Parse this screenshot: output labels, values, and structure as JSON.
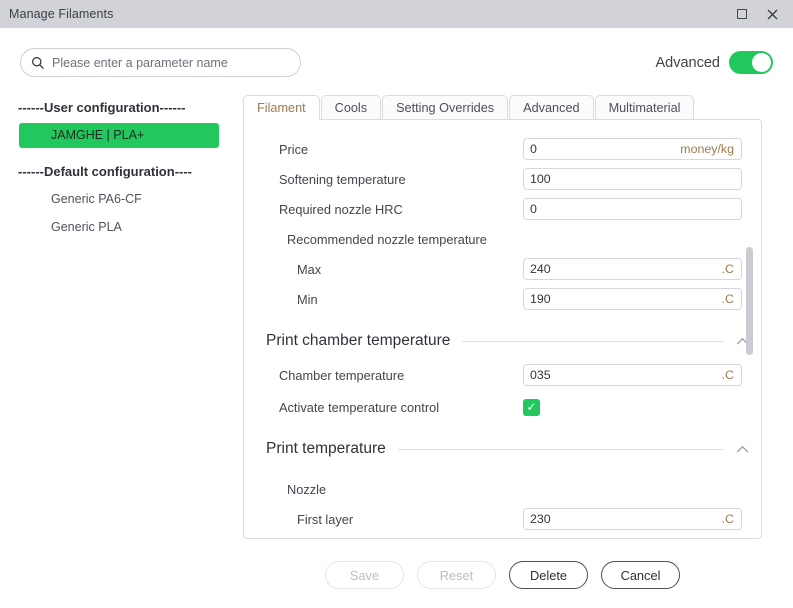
{
  "window": {
    "title": "Manage Filaments",
    "maximize_icon": "square-maximize-icon",
    "close_icon": "close-x-icon"
  },
  "search": {
    "placeholder": "Please enter a parameter name",
    "value": "",
    "icon": "search-icon"
  },
  "advanced": {
    "label": "Advanced",
    "enabled": true,
    "accent_color": "#21c95c"
  },
  "sidebar": {
    "groups": [
      {
        "header": "------User configuration------",
        "items": [
          {
            "label": "JAMGHE | PLA+",
            "selected": true
          }
        ]
      },
      {
        "header": "------Default configuration----",
        "items": [
          {
            "label": "Generic PA6-CF",
            "selected": false
          },
          {
            "label": "Generic PLA",
            "selected": false
          }
        ]
      }
    ],
    "selected_color": "#22c85d"
  },
  "tabs": [
    {
      "label": "Filament",
      "active": true
    },
    {
      "label": "Cools",
      "active": false
    },
    {
      "label": "Setting Overrides",
      "active": false
    },
    {
      "label": "Advanced",
      "active": false
    },
    {
      "label": "Multimaterial",
      "active": false
    }
  ],
  "tab_active_color": "#9d7b4f",
  "form": {
    "rows": [
      {
        "type": "field",
        "label": "Price",
        "indent": 0,
        "value": "0",
        "unit": "money/kg"
      },
      {
        "type": "field",
        "label": "Softening temperature",
        "indent": 0,
        "value": "100",
        "unit": ""
      },
      {
        "type": "field",
        "label": "Required nozzle HRC",
        "indent": 0,
        "value": "0",
        "unit": ""
      },
      {
        "type": "grouplabel",
        "label": "Recommended nozzle temperature",
        "indent": 1
      },
      {
        "type": "field",
        "label": "Max",
        "indent": 2,
        "value": "240",
        "unit": ".C"
      },
      {
        "type": "field",
        "label": "Min",
        "indent": 2,
        "value": "190",
        "unit": ".C"
      },
      {
        "type": "section",
        "label": "Print chamber temperature",
        "collapse_icon": "chevron-up-icon"
      },
      {
        "type": "field",
        "label": "Chamber temperature",
        "indent": 0,
        "value": "035",
        "unit": ".C"
      },
      {
        "type": "checkbox",
        "label": "Activate temperature control",
        "indent": 0,
        "checked": true
      },
      {
        "type": "section",
        "label": "Print temperature",
        "collapse_icon": "chevron-up-icon"
      },
      {
        "type": "grouplabel",
        "label": "Nozzle",
        "indent": 1
      },
      {
        "type": "field",
        "label": "First layer",
        "indent": 2,
        "value": "230",
        "unit": ".C"
      },
      {
        "type": "clipped"
      }
    ]
  },
  "scrollbar": {
    "thumb_color": "#c9ccd1"
  },
  "footer": {
    "buttons": [
      {
        "label": "Save",
        "enabled": false
      },
      {
        "label": "Reset",
        "enabled": false
      },
      {
        "label": "Delete",
        "enabled": true
      },
      {
        "label": "Cancel",
        "enabled": true
      }
    ]
  }
}
